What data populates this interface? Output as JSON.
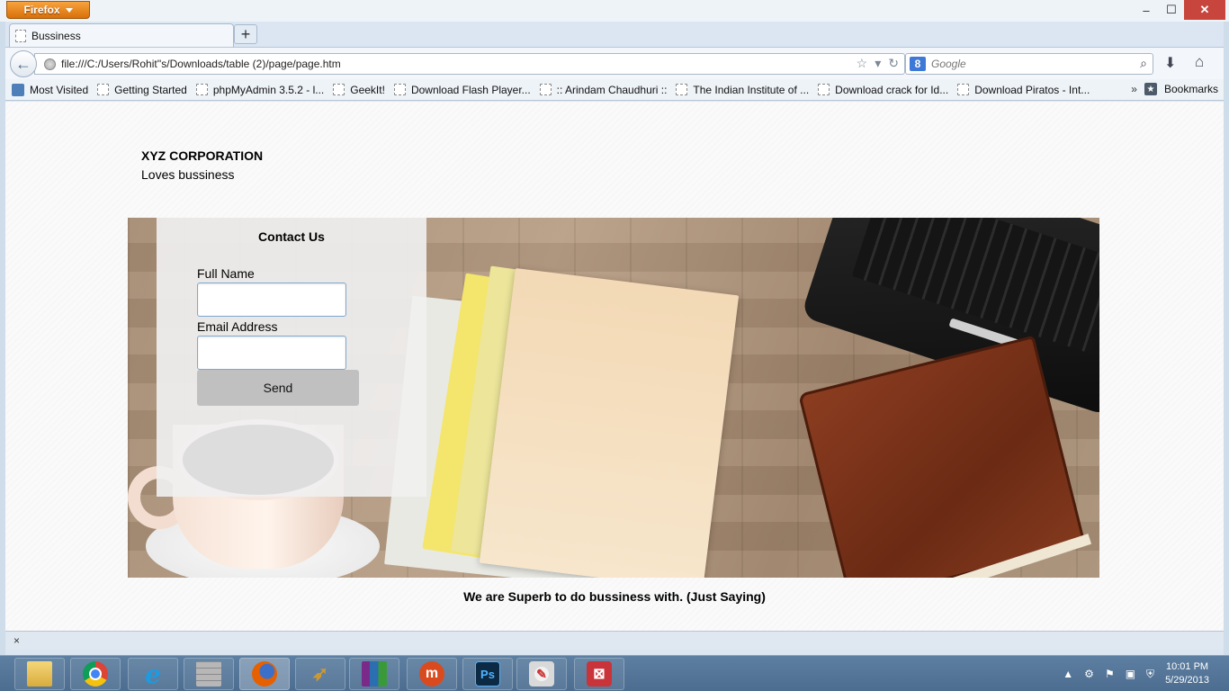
{
  "browser": {
    "app_button": "Firefox",
    "tab_title": "Bussiness",
    "new_tab": "+",
    "url": "file:///C:/Users/Rohit''s/Downloads/table (2)/page/page.htm",
    "search_placeholder": "Google",
    "search_engine_letter": "8",
    "window_controls": {
      "minimize": "–",
      "maximize": "☐",
      "close": "✕"
    }
  },
  "bookmarks": {
    "items": [
      "Most Visited",
      "Getting Started",
      "phpMyAdmin 3.5.2 - l...",
      "GeekIt!",
      "Download Flash Player...",
      ":: Arindam Chaudhuri ::",
      "The Indian Institute of ...",
      "Download crack for Id...",
      "Download Piratos - Int..."
    ],
    "overflow": "»",
    "bookmarks_label": "Bookmarks"
  },
  "page": {
    "brand": "XYZ CORPORATION",
    "tagline": "Loves bussiness",
    "contact": {
      "title": "Contact Us",
      "name_label": "Full Name",
      "name_value": "",
      "email_label": "Email Address",
      "email_value": "",
      "send_label": "Send"
    },
    "footer": "We are Superb to do bussiness with. (Just Saying)"
  },
  "addon_bar": {
    "close": "×"
  },
  "taskbar": {
    "apps": [
      "file-explorer",
      "chrome",
      "internet-explorer",
      "firewall",
      "firefox",
      "launcher",
      "winrar",
      "media-player",
      "photoshop",
      "paint",
      "pdf-reader"
    ],
    "labels": {
      "ie": "e",
      "ps": "Ps",
      "m": "m",
      "rar": "",
      "red": "⊠"
    },
    "time": "10:01 PM",
    "date": "5/29/2013"
  },
  "colors": {
    "firefox_orange": "#e8820f",
    "close_red": "#c7453d",
    "send_button": "#c0c0c0",
    "taskbar": "#5d7fa1"
  }
}
